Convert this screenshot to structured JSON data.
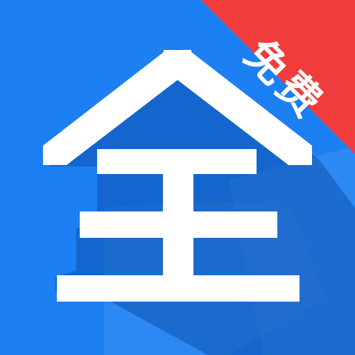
{
  "app_icon": {
    "glyph": "全",
    "badge_text": "免费",
    "colors": {
      "background": "#1c7ff2",
      "background_dark": "#1767cf",
      "shadow": "#0e52b0",
      "glyph": "#ffffff",
      "badge_ribbon": "#f03c3c"
    },
    "icon_names": [
      "app-glyph-quan",
      "free-corner-ribbon"
    ]
  }
}
